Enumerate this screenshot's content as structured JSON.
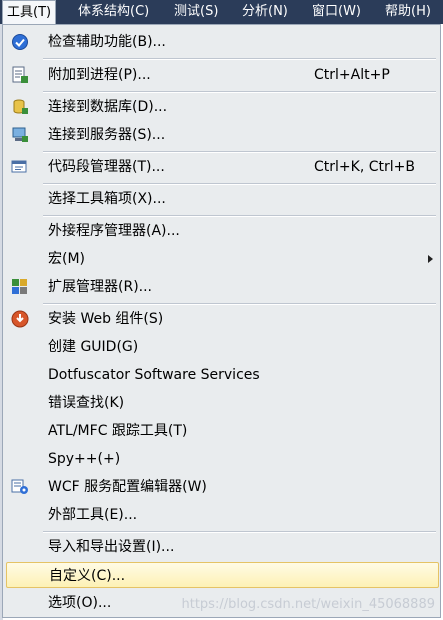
{
  "menubar": {
    "items": [
      {
        "label": "工具(T)"
      },
      {
        "label": "体系结构(C)"
      },
      {
        "label": "测试(S)"
      },
      {
        "label": "分析(N)"
      },
      {
        "label": "窗口(W)"
      },
      {
        "label": "帮助(H)"
      }
    ]
  },
  "menu": {
    "items": [
      {
        "label": "检查辅助功能(B)...",
        "shortcut": "",
        "icon": "accessibility-check-icon"
      },
      {
        "label": "附加到进程(P)...",
        "shortcut": "Ctrl+Alt+P",
        "icon": "attach-process-icon"
      },
      {
        "label": "连接到数据库(D)...",
        "shortcut": "",
        "icon": "connect-database-icon"
      },
      {
        "label": "连接到服务器(S)...",
        "shortcut": "",
        "icon": "connect-server-icon"
      },
      {
        "label": "代码段管理器(T)...",
        "shortcut": "Ctrl+K, Ctrl+B",
        "icon": "code-snippets-icon"
      },
      {
        "label": "选择工具箱项(X)...",
        "shortcut": ""
      },
      {
        "label": "外接程序管理器(A)...",
        "shortcut": ""
      },
      {
        "label": "宏(M)",
        "shortcut": "",
        "submenu": true
      },
      {
        "label": "扩展管理器(R)...",
        "shortcut": "",
        "icon": "extension-manager-icon"
      },
      {
        "label": "安装 Web 组件(S)",
        "shortcut": "",
        "icon": "install-web-component-icon"
      },
      {
        "label": "创建 GUID(G)",
        "shortcut": ""
      },
      {
        "label": "Dotfuscator Software Services",
        "shortcut": ""
      },
      {
        "label": "错误查找(K)",
        "shortcut": ""
      },
      {
        "label": "ATL/MFC 跟踪工具(T)",
        "shortcut": ""
      },
      {
        "label": "Spy++(+)",
        "shortcut": ""
      },
      {
        "label": "WCF 服务配置编辑器(W)",
        "shortcut": "",
        "icon": "wcf-config-icon"
      },
      {
        "label": "外部工具(E)...",
        "shortcut": ""
      },
      {
        "label": "导入和导出设置(I)...",
        "shortcut": ""
      },
      {
        "label": "自定义(C)...",
        "shortcut": "",
        "highlighted": true
      },
      {
        "label": "选项(O)...",
        "shortcut": ""
      }
    ]
  },
  "watermark": "https://blog.csdn.net/weixin_45068889",
  "colors": {
    "menubar_bg": "#2b3c59",
    "menu_bg": "#e9ecee",
    "highlight_border": "#e5c365",
    "highlight_fill": "#fdf1b5"
  }
}
